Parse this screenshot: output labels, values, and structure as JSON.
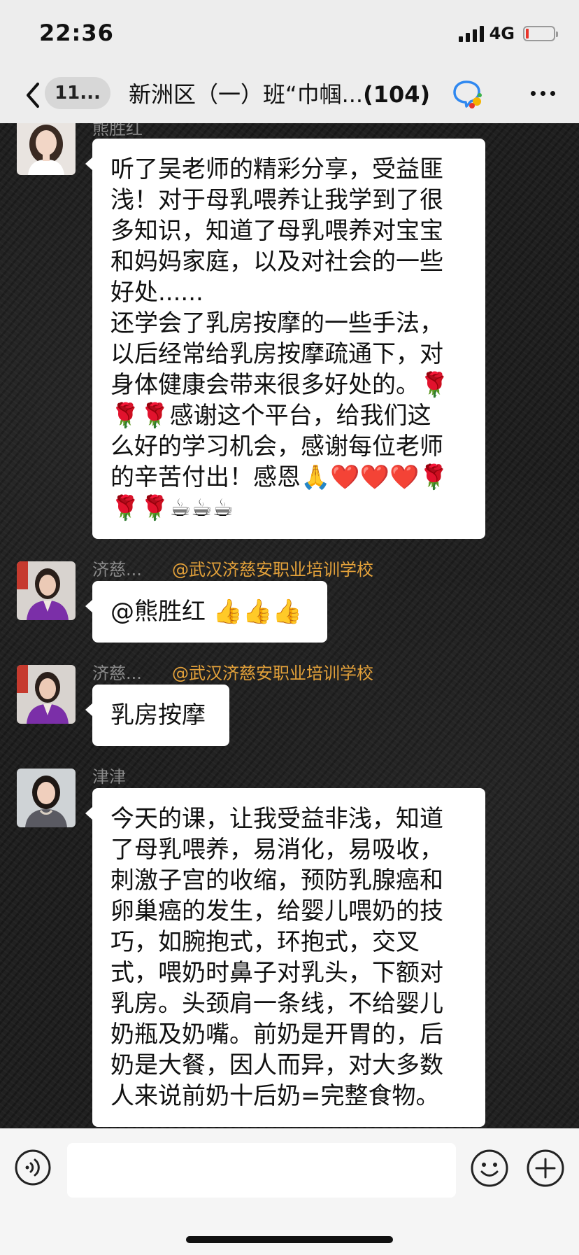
{
  "status_bar": {
    "time": "22:36",
    "network": "4G"
  },
  "nav": {
    "unread": "11...",
    "title": "新洲区（一）班“巾帼...",
    "member_count": "(104)"
  },
  "messages": [
    {
      "sender": "熊胜红",
      "lines": [
        "听了吴老师的精彩分享，受益匪",
        "浅！对于母乳喂养让我学到了很",
        "多知识，知道了母乳喂养对宝宝",
        "和妈妈家庭，以及对社会的一些",
        "好处......",
        "还学会了乳房按摩的一些手法，",
        "以后经常给乳房按摩疏通下，对",
        "身体健康会带来很多好处的。🌹",
        "🌹🌹感谢这个平台，给我们这",
        "么好的学习机会，感谢每位老师",
        "的辛苦付出！感恩🙏❤️❤️❤️🌹",
        "🌹🌹☕☕☕"
      ]
    },
    {
      "sender": "济慈...",
      "mention": "@武汉济慈安职业培训学校",
      "lines": [
        "@熊胜红 👍👍👍"
      ]
    },
    {
      "sender": "济慈...",
      "mention": "@武汉济慈安职业培训学校",
      "lines": [
        "乳房按摩"
      ]
    },
    {
      "sender": "津津",
      "lines": [
        "今天的课，让我受益非浅，知道",
        "了母乳喂养，易消化，易吸收，",
        "刺激子宫的收缩，预防乳腺癌和",
        "卵巢癌的发生，给婴儿喂奶的技",
        "巧，如腕抱式，环抱式，交叉",
        "式，喂奶时鼻子对乳头，下额对",
        "乳房。头颈肩一条线，不给婴儿",
        "奶瓶及奶嘴。前奶是开胃的，后",
        "奶是大餐，因人而异，对大多数",
        "人来说前奶十后奶=完整食物。"
      ]
    }
  ],
  "input": {
    "value": ""
  },
  "colors": {
    "mention": "#e3a13a",
    "chat_background": "#202020",
    "bar_background": "#ededed"
  },
  "icons": [
    "back-arrow-icon",
    "chat-mark-icon",
    "more-icon",
    "voice-icon",
    "emoji-icon",
    "plus-icon"
  ]
}
